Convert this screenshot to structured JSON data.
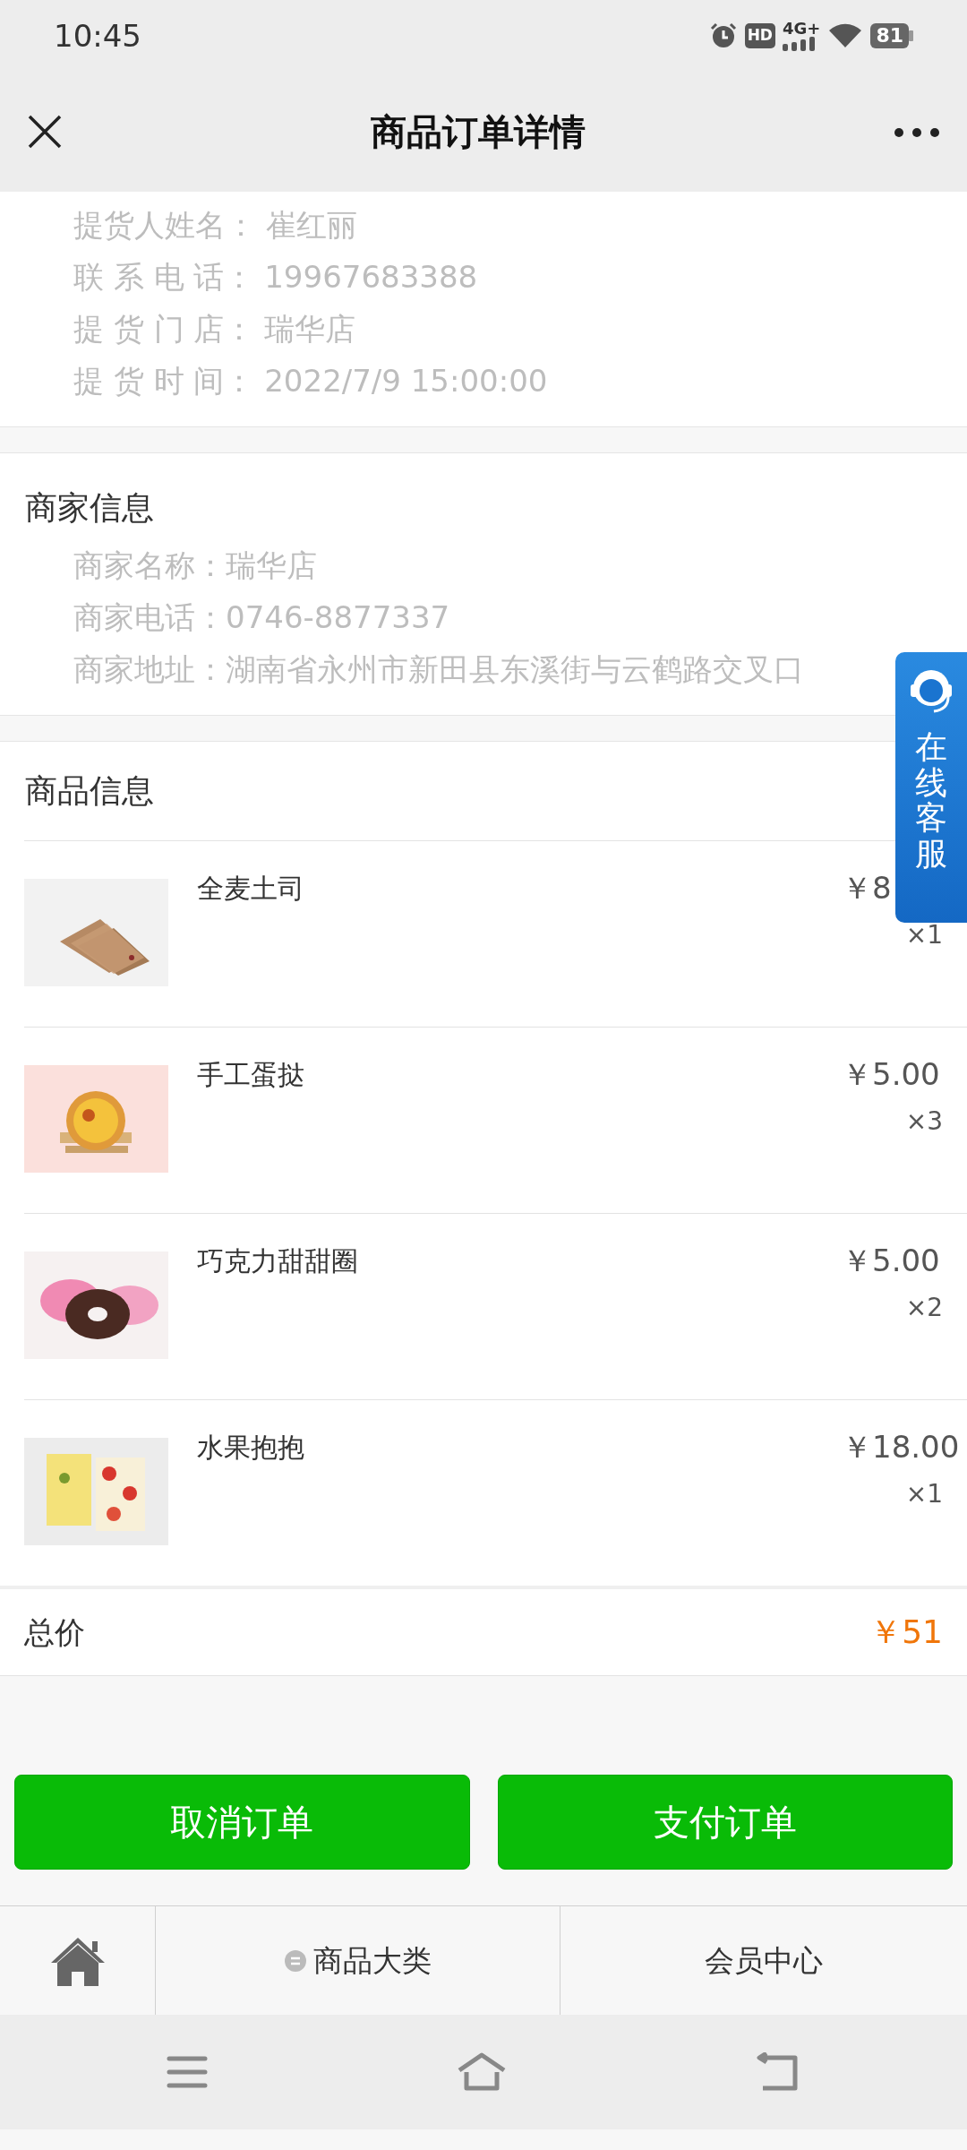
{
  "status_bar": {
    "time": "10:45",
    "hd": "HD",
    "network": "4G+",
    "battery": "81"
  },
  "header": {
    "title": "商品订单详情"
  },
  "pickup_info": [
    {
      "label": "提货人姓名：",
      "value": "崔红丽"
    },
    {
      "label": "联 系 电 话：",
      "value": "19967683388"
    },
    {
      "label": "提 货 门 店：",
      "value": "瑞华店"
    },
    {
      "label": "提 货 时 间：",
      "value": "2022/7/9 15:00:00"
    }
  ],
  "merchant": {
    "title": "商家信息",
    "rows": [
      {
        "label": "商家名称：",
        "value": "瑞华店"
      },
      {
        "label": "商家电话：",
        "value": "0746-8877337"
      },
      {
        "label": "商家地址：",
        "value": "湖南省永州市新田县东溪街与云鹤路交叉口"
      }
    ]
  },
  "products": {
    "title": "商品信息",
    "items": [
      {
        "name": "全麦土司",
        "price": "￥8",
        "qty": "×1"
      },
      {
        "name": "手工蛋挞",
        "price": "￥5.00",
        "qty": "×3"
      },
      {
        "name": "巧克力甜甜圈",
        "price": "￥5.00",
        "qty": "×2"
      },
      {
        "name": "水果抱抱",
        "price": "￥18.00",
        "qty": "×1"
      }
    ]
  },
  "total": {
    "label": "总价",
    "value": "￥51"
  },
  "buttons": [
    "取消订单",
    "支付订单"
  ],
  "service_float": {
    "label": "在线客服"
  },
  "bottom_nav": [
    {
      "kind": "home"
    },
    {
      "kind": "category",
      "label": "商品大类"
    },
    {
      "kind": "text",
      "label": "会员中心"
    }
  ]
}
